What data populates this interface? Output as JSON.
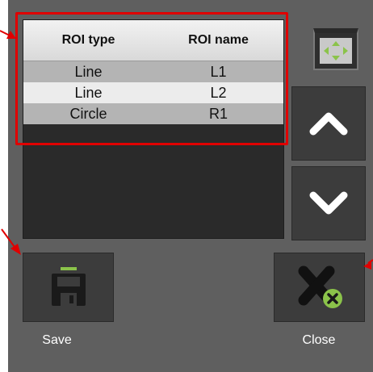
{
  "table": {
    "headers": [
      "ROI type",
      "ROI name"
    ],
    "rows": [
      {
        "type": "Line",
        "name": "L1"
      },
      {
        "type": "Line",
        "name": "L2"
      },
      {
        "type": "Circle",
        "name": "R1"
      }
    ]
  },
  "buttons": {
    "save_label": "Save",
    "close_label": "Close"
  },
  "icons": {
    "fit": "fit-view-icon",
    "up": "chevron-up-icon",
    "down": "chevron-down-icon",
    "save": "floppy-disk-icon",
    "close": "close-x-icon"
  },
  "colors": {
    "panel": "#5f5f5f",
    "button": "#3c3c3c",
    "accent": "#8bc34a",
    "annotation": "#e00000"
  }
}
